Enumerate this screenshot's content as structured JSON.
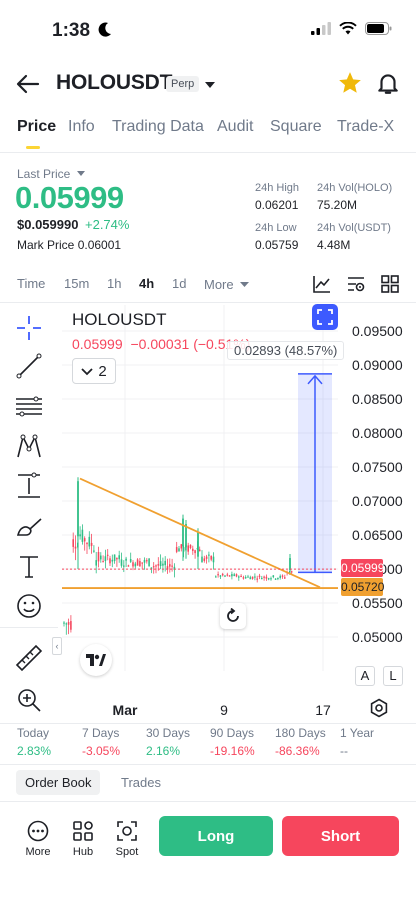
{
  "status": {
    "time": "1:38"
  },
  "header": {
    "pair": "HOLOUSDT",
    "contract_type": "Perp"
  },
  "tabs": [
    "Price",
    "Info",
    "Trading Data",
    "Audit",
    "Square",
    "Trade-X"
  ],
  "ticker": {
    "last_price_label": "Last Price",
    "last_price": "0.05999",
    "usd_price": "$0.059990",
    "change_pct": "+2.74%",
    "mark_price_label": "Mark Price",
    "mark_price": "0.06001",
    "high_label": "24h High",
    "high": "0.06201",
    "vol_holo_label": "24h Vol(HOLO)",
    "vol_holo": "75.20M",
    "low_label": "24h Low",
    "low": "0.05759",
    "vol_usdt_label": "24h Vol(USDT)",
    "vol_usdt": "4.48M"
  },
  "intervals": [
    "Time",
    "15m",
    "1h",
    "4h",
    "1d",
    "More"
  ],
  "active_interval": "4h",
  "chart": {
    "symbol": "HOLOUSDT",
    "interval_count": "2",
    "last": "0.05999",
    "change": "−0.00031",
    "change_pct": "(−0.51%)",
    "measure_label": "0.02893 (48.57%)",
    "price_badge": "0.05999",
    "line_badge": "0.05720",
    "y_ticks": [
      "0.09500",
      "0.09000",
      "0.08500",
      "0.08000",
      "0.07500",
      "0.07000",
      "0.06500",
      "0.06000",
      "0.05500",
      "0.05000"
    ],
    "x_ticks": [
      "Mar",
      "9",
      "17"
    ],
    "scale_auto": "A",
    "scale_log": "L",
    "colors": {
      "up": "#2ebd85",
      "down": "#f6465d",
      "trend": "#f0a030",
      "measure": "#3d5afe"
    }
  },
  "periods": [
    {
      "label": "Today",
      "value": "2.83%",
      "dir": "up"
    },
    {
      "label": "7 Days",
      "value": "-3.05%",
      "dir": "down"
    },
    {
      "label": "30 Days",
      "value": "2.16%",
      "dir": "up"
    },
    {
      "label": "90 Days",
      "value": "-19.16%",
      "dir": "down"
    },
    {
      "label": "180 Days",
      "value": "-86.36%",
      "dir": "down"
    },
    {
      "label": "1 Year",
      "value": "--",
      "dir": "none"
    }
  ],
  "book_tabs": {
    "order_book": "Order Book",
    "trades": "Trades"
  },
  "bottom": {
    "more": "More",
    "hub": "Hub",
    "spot": "Spot",
    "long": "Long",
    "short": "Short"
  }
}
